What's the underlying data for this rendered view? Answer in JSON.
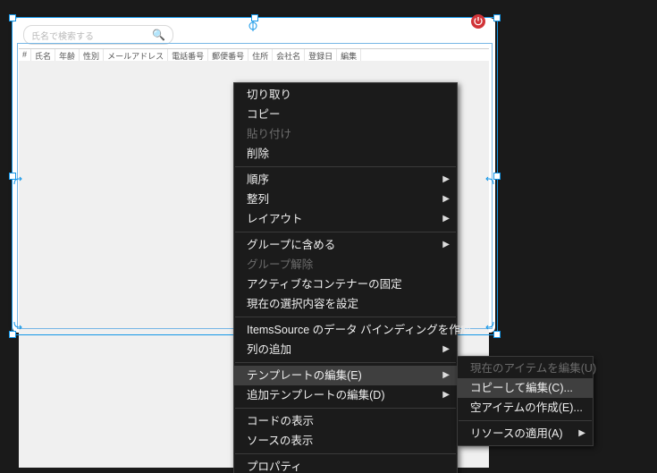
{
  "search": {
    "placeholder": "氏名で検索する"
  },
  "grid_columns": [
    "#",
    "氏名",
    "年齢",
    "性別",
    "メールアドレス",
    "電話番号",
    "郵便番号",
    "住所",
    "会社名",
    "登録日",
    "編集"
  ],
  "menu": {
    "items": [
      {
        "label": "切り取り",
        "type": "item"
      },
      {
        "label": "コピー",
        "type": "item"
      },
      {
        "label": "貼り付け",
        "type": "item",
        "disabled": true
      },
      {
        "label": "削除",
        "type": "item"
      },
      {
        "type": "sep"
      },
      {
        "label": "順序",
        "type": "sub"
      },
      {
        "label": "整列",
        "type": "sub"
      },
      {
        "label": "レイアウト",
        "type": "sub"
      },
      {
        "type": "sep"
      },
      {
        "label": "グループに含める",
        "type": "sub"
      },
      {
        "label": "グループ解除",
        "type": "item",
        "disabled": true
      },
      {
        "label": "アクティブなコンテナーの固定",
        "type": "item"
      },
      {
        "label": "現在の選択内容を設定",
        "type": "item"
      },
      {
        "type": "sep"
      },
      {
        "label": "ItemsSource のデータ バインディングを作成...",
        "type": "item"
      },
      {
        "label": "列の追加",
        "type": "sub"
      },
      {
        "type": "sep"
      },
      {
        "label": "テンプレートの編集(E)",
        "type": "sub",
        "hover": true
      },
      {
        "label": "追加テンプレートの編集(D)",
        "type": "sub"
      },
      {
        "type": "sep"
      },
      {
        "label": "コードの表示",
        "type": "item"
      },
      {
        "label": "ソースの表示",
        "type": "item"
      },
      {
        "type": "sep"
      },
      {
        "label": "プロパティ",
        "type": "item"
      }
    ]
  },
  "submenu": {
    "items": [
      {
        "label": "現在のアイテムを編集(U)",
        "type": "item",
        "disabled": true
      },
      {
        "label": "コピーして編集(C)...",
        "type": "item",
        "hover": true
      },
      {
        "label": "空アイテムの作成(E)...",
        "type": "item"
      },
      {
        "type": "sep"
      },
      {
        "label": "リソースの適用(A)",
        "type": "sub"
      }
    ]
  }
}
